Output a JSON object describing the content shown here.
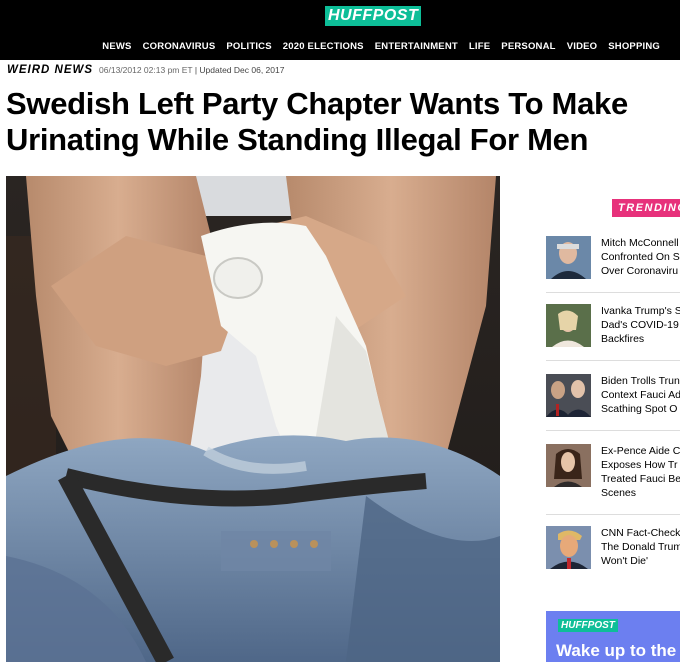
{
  "brand": {
    "logo_text": "HUFFPOST",
    "logo_color": "#0dbe98"
  },
  "nav": {
    "items": [
      "NEWS",
      "CORONAVIRUS",
      "POLITICS",
      "2020 ELECTIONS",
      "ENTERTAINMENT",
      "LIFE",
      "PERSONAL",
      "VIDEO",
      "SHOPPING"
    ]
  },
  "article": {
    "kicker": "WEIRD NEWS",
    "published": "06/13/2012 02:13 pm ET",
    "updated": "| Updated Dec 06, 2017",
    "headline_line1": "Swedish Left Party Chapter Wants To Make",
    "headline_line2": "Urinating While Standing Illegal For Men"
  },
  "sidebar": {
    "trending_label": "TRENDING",
    "trending_color": "#e7317b",
    "items": [
      {
        "lines": [
          "Mitch McConnell",
          "Confronted On S",
          "Over Coronaviru"
        ]
      },
      {
        "lines": [
          "Ivanka Trump's S",
          "Dad's COVID-19",
          "Backfires"
        ]
      },
      {
        "lines": [
          "Biden Trolls Trun",
          "Context Fauci Ad",
          "Scathing Spot O"
        ]
      },
      {
        "lines": [
          "Ex-Pence Aide C",
          "Exposes How Tr",
          "Treated Fauci Be",
          "Scenes"
        ]
      },
      {
        "lines": [
          "CNN Fact-Check",
          "The Donald Trum",
          "Won't Die'"
        ]
      }
    ],
    "promo": {
      "logo_text": "HUFFPOST",
      "text": "Wake up to the",
      "color": "#6c7ff0"
    }
  }
}
